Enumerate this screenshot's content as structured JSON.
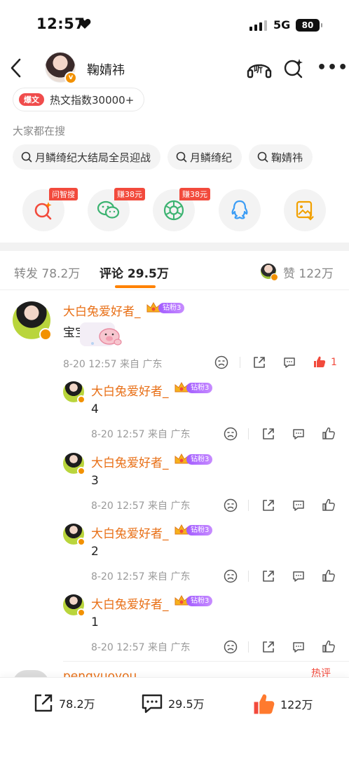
{
  "status_bar": {
    "time": "12:57",
    "network": "5G",
    "battery": "80"
  },
  "header": {
    "name": "鞠婧祎",
    "listen_label": "听"
  },
  "hot_tag": {
    "badge": "爆文",
    "text": "热文指数30000+"
  },
  "search": {
    "title": "大家都在搜",
    "chips": [
      "月鳞绮纪大结局全员迎战",
      "月鳞绮纪",
      "鞠婧祎"
    ]
  },
  "share_targets": [
    {
      "icon": "ai-search-icon",
      "tag": "问智搜"
    },
    {
      "icon": "wechat-icon",
      "tag": "赚38元"
    },
    {
      "icon": "moments-icon",
      "tag": "赚38元"
    },
    {
      "icon": "qq-icon",
      "tag": ""
    },
    {
      "icon": "save-image-icon",
      "tag": ""
    }
  ],
  "tabs": {
    "repost": "转发 78.2万",
    "comments": "评论 29.5万",
    "likes": "赞 122万"
  },
  "comments": [
    {
      "name": "大白兔爱好者_",
      "fan_badge": "钻粉3",
      "text": "宝宝",
      "meta": "8-20 12:57  来自 广东",
      "likes": "1"
    },
    {
      "name": "大白兔爱好者_",
      "fan_badge": "钻粉3",
      "text": "4",
      "meta": "8-20 12:57  来自 广东"
    },
    {
      "name": "大白兔爱好者_",
      "fan_badge": "钻粉3",
      "text": "3",
      "meta": "8-20 12:57  来自 广东"
    },
    {
      "name": "大白兔爱好者_",
      "fan_badge": "钻粉3",
      "text": "2",
      "meta": "8-20 12:57  来自 广东"
    },
    {
      "name": "大白兔爱好者_",
      "fan_badge": "钻粉3",
      "text": "1",
      "meta": "8-20 12:57  来自 广东"
    }
  ],
  "next_comment_peek": {
    "name": "pengyuoyou",
    "tag": "热评"
  },
  "bottom_bar": {
    "reposts": "78.2万",
    "comments": "29.5万",
    "likes": "122万"
  },
  "colors": {
    "accent": "#ff8200",
    "username": "#e86f16",
    "like_red": "#f24a3c",
    "fan_badge": "#a25cff"
  }
}
